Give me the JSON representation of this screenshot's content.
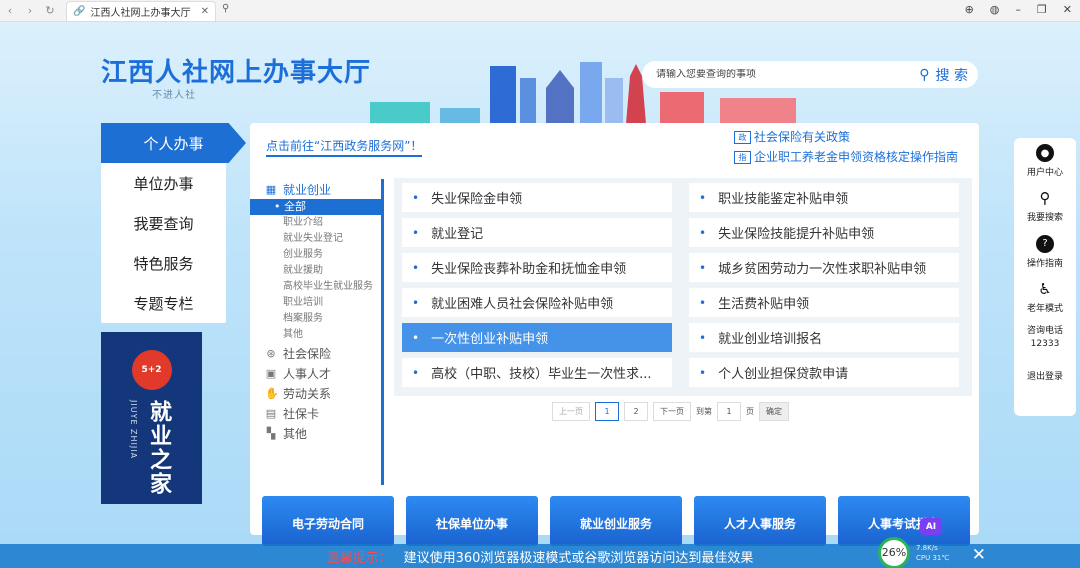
{
  "browser": {
    "tab_title": "江西人社网上办事大厅",
    "close_glyph": "✕"
  },
  "header": {
    "title": "江西人社网上办事大厅",
    "subtitle": "不进人社",
    "search_placeholder": "请输入您要查询的事项",
    "search_button": "搜 索"
  },
  "leftnav": {
    "items": [
      {
        "label": "个人办事"
      },
      {
        "label": "单位办事"
      },
      {
        "label": "我要查询"
      },
      {
        "label": "特色服务"
      },
      {
        "label": "专题专栏"
      }
    ]
  },
  "banner": {
    "logo_text": "5+2",
    "en_text": "JIUYE ZHIJIA",
    "cn_text": "就业之家"
  },
  "main": {
    "top_link": "点击前往“江西政务服务网”！",
    "policy_links": [
      {
        "icon": "政",
        "label": "社会保险有关政策"
      },
      {
        "icon": "指",
        "label": "企业职工养老金申领资格核定操作指南"
      }
    ],
    "categories": {
      "employment": "就业创业",
      "subs": [
        "全部",
        "职业介绍",
        "就业失业登记",
        "创业服务",
        "就业援助",
        "高校毕业生就业服务",
        "职业培训",
        "档案服务",
        "其他"
      ],
      "others": [
        "社会保险",
        "人事人才",
        "劳动关系",
        "社保卡",
        "其他"
      ]
    },
    "services": [
      "失业保险金申领",
      "职业技能鉴定补贴申领",
      "就业登记",
      "失业保险技能提升补贴申领",
      "失业保险丧葬补助金和抚恤金申领",
      "城乡贫困劳动力一次性求职补贴申领",
      "就业困难人员社会保险补贴申领",
      "生活费补贴申领",
      "一次性创业补贴申领",
      "就业创业培训报名",
      "高校（中职、技校）毕业生一次性求...",
      "个人创业担保贷款申请"
    ],
    "pager": {
      "prev": "上一页",
      "page1": "1",
      "page2": "2",
      "next": "下一页",
      "goto": "到第",
      "page_input": "1",
      "page_unit": "页",
      "confirm": "确定"
    }
  },
  "cards": [
    "电子劳动合同",
    "社保单位办事",
    "就业创业服务",
    "人才人事服务",
    "人事考试报名"
  ],
  "right_sidebar": [
    {
      "label": "用户中心"
    },
    {
      "label": "我要搜索"
    },
    {
      "label": "操作指南"
    },
    {
      "label": "老年模式"
    },
    {
      "label": "咨询电话",
      "value": "12333"
    },
    {
      "label": "退出登录"
    }
  ],
  "footer": {
    "warning_label": "温馨提示：",
    "warning_text": "建议使用360浏览器极速模式或谷歌浏览器访问达到最佳效果"
  },
  "widget": {
    "percent": "26%",
    "speed": "7.8K/s",
    "cpu": "CPU 31℃",
    "ai": "AI"
  }
}
